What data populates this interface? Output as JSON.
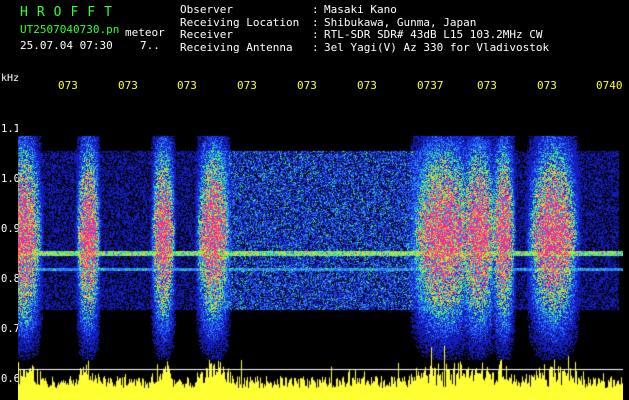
{
  "header": {
    "app_title": "HROFFT",
    "filename": "UT2507040730.pn",
    "detector": "meteor",
    "timestamp": "25.07.04 07:30",
    "count": "7.."
  },
  "meta": {
    "observer_label": "Observer",
    "observer_value": "Masaki Kano",
    "location_label": "Receiving Location",
    "location_value": "Shibukawa, Gunma, Japan",
    "receiver_label": "Receiver",
    "receiver_value": "RTL-SDR SDR# 43dB L15 103.2MHz CW",
    "antenna_label": "Receiving Antenna",
    "antenna_value": "3el Yagi(V) Az 330 for Vladivostok",
    "separator": ":"
  },
  "axis": {
    "unit": "kHz",
    "y_ticks": [
      "1.1",
      "1.0",
      "0.9",
      "0.8",
      "0.7",
      "0.6"
    ],
    "x_ticks": [
      "073",
      "073",
      "073",
      "073",
      "073",
      "073",
      "0737",
      "073",
      "073",
      "0740"
    ]
  },
  "colors": {
    "background": "#000000",
    "title_green": "#33ff33",
    "text_white": "#ffffff",
    "time_yellow": "#ffff33",
    "noise_blue": "#1b2cff",
    "echo_pink": "#ff2a88"
  }
}
